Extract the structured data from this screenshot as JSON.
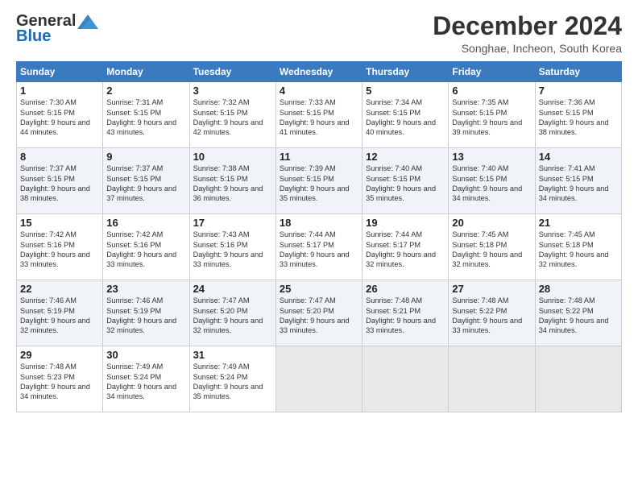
{
  "header": {
    "logo_general": "General",
    "logo_blue": "Blue",
    "month_title": "December 2024",
    "subtitle": "Songhae, Incheon, South Korea"
  },
  "weekdays": [
    "Sunday",
    "Monday",
    "Tuesday",
    "Wednesday",
    "Thursday",
    "Friday",
    "Saturday"
  ],
  "weeks": [
    [
      {
        "day": "1",
        "sunrise": "Sunrise: 7:30 AM",
        "sunset": "Sunset: 5:15 PM",
        "daylight": "Daylight: 9 hours and 44 minutes."
      },
      {
        "day": "2",
        "sunrise": "Sunrise: 7:31 AM",
        "sunset": "Sunset: 5:15 PM",
        "daylight": "Daylight: 9 hours and 43 minutes."
      },
      {
        "day": "3",
        "sunrise": "Sunrise: 7:32 AM",
        "sunset": "Sunset: 5:15 PM",
        "daylight": "Daylight: 9 hours and 42 minutes."
      },
      {
        "day": "4",
        "sunrise": "Sunrise: 7:33 AM",
        "sunset": "Sunset: 5:15 PM",
        "daylight": "Daylight: 9 hours and 41 minutes."
      },
      {
        "day": "5",
        "sunrise": "Sunrise: 7:34 AM",
        "sunset": "Sunset: 5:15 PM",
        "daylight": "Daylight: 9 hours and 40 minutes."
      },
      {
        "day": "6",
        "sunrise": "Sunrise: 7:35 AM",
        "sunset": "Sunset: 5:15 PM",
        "daylight": "Daylight: 9 hours and 39 minutes."
      },
      {
        "day": "7",
        "sunrise": "Sunrise: 7:36 AM",
        "sunset": "Sunset: 5:15 PM",
        "daylight": "Daylight: 9 hours and 38 minutes."
      }
    ],
    [
      {
        "day": "8",
        "sunrise": "Sunrise: 7:37 AM",
        "sunset": "Sunset: 5:15 PM",
        "daylight": "Daylight: 9 hours and 38 minutes."
      },
      {
        "day": "9",
        "sunrise": "Sunrise: 7:37 AM",
        "sunset": "Sunset: 5:15 PM",
        "daylight": "Daylight: 9 hours and 37 minutes."
      },
      {
        "day": "10",
        "sunrise": "Sunrise: 7:38 AM",
        "sunset": "Sunset: 5:15 PM",
        "daylight": "Daylight: 9 hours and 36 minutes."
      },
      {
        "day": "11",
        "sunrise": "Sunrise: 7:39 AM",
        "sunset": "Sunset: 5:15 PM",
        "daylight": "Daylight: 9 hours and 35 minutes."
      },
      {
        "day": "12",
        "sunrise": "Sunrise: 7:40 AM",
        "sunset": "Sunset: 5:15 PM",
        "daylight": "Daylight: 9 hours and 35 minutes."
      },
      {
        "day": "13",
        "sunrise": "Sunrise: 7:40 AM",
        "sunset": "Sunset: 5:15 PM",
        "daylight": "Daylight: 9 hours and 34 minutes."
      },
      {
        "day": "14",
        "sunrise": "Sunrise: 7:41 AM",
        "sunset": "Sunset: 5:15 PM",
        "daylight": "Daylight: 9 hours and 34 minutes."
      }
    ],
    [
      {
        "day": "15",
        "sunrise": "Sunrise: 7:42 AM",
        "sunset": "Sunset: 5:16 PM",
        "daylight": "Daylight: 9 hours and 33 minutes."
      },
      {
        "day": "16",
        "sunrise": "Sunrise: 7:42 AM",
        "sunset": "Sunset: 5:16 PM",
        "daylight": "Daylight: 9 hours and 33 minutes."
      },
      {
        "day": "17",
        "sunrise": "Sunrise: 7:43 AM",
        "sunset": "Sunset: 5:16 PM",
        "daylight": "Daylight: 9 hours and 33 minutes."
      },
      {
        "day": "18",
        "sunrise": "Sunrise: 7:44 AM",
        "sunset": "Sunset: 5:17 PM",
        "daylight": "Daylight: 9 hours and 33 minutes."
      },
      {
        "day": "19",
        "sunrise": "Sunrise: 7:44 AM",
        "sunset": "Sunset: 5:17 PM",
        "daylight": "Daylight: 9 hours and 32 minutes."
      },
      {
        "day": "20",
        "sunrise": "Sunrise: 7:45 AM",
        "sunset": "Sunset: 5:18 PM",
        "daylight": "Daylight: 9 hours and 32 minutes."
      },
      {
        "day": "21",
        "sunrise": "Sunrise: 7:45 AM",
        "sunset": "Sunset: 5:18 PM",
        "daylight": "Daylight: 9 hours and 32 minutes."
      }
    ],
    [
      {
        "day": "22",
        "sunrise": "Sunrise: 7:46 AM",
        "sunset": "Sunset: 5:19 PM",
        "daylight": "Daylight: 9 hours and 32 minutes."
      },
      {
        "day": "23",
        "sunrise": "Sunrise: 7:46 AM",
        "sunset": "Sunset: 5:19 PM",
        "daylight": "Daylight: 9 hours and 32 minutes."
      },
      {
        "day": "24",
        "sunrise": "Sunrise: 7:47 AM",
        "sunset": "Sunset: 5:20 PM",
        "daylight": "Daylight: 9 hours and 32 minutes."
      },
      {
        "day": "25",
        "sunrise": "Sunrise: 7:47 AM",
        "sunset": "Sunset: 5:20 PM",
        "daylight": "Daylight: 9 hours and 33 minutes."
      },
      {
        "day": "26",
        "sunrise": "Sunrise: 7:48 AM",
        "sunset": "Sunset: 5:21 PM",
        "daylight": "Daylight: 9 hours and 33 minutes."
      },
      {
        "day": "27",
        "sunrise": "Sunrise: 7:48 AM",
        "sunset": "Sunset: 5:22 PM",
        "daylight": "Daylight: 9 hours and 33 minutes."
      },
      {
        "day": "28",
        "sunrise": "Sunrise: 7:48 AM",
        "sunset": "Sunset: 5:22 PM",
        "daylight": "Daylight: 9 hours and 34 minutes."
      }
    ],
    [
      {
        "day": "29",
        "sunrise": "Sunrise: 7:48 AM",
        "sunset": "Sunset: 5:23 PM",
        "daylight": "Daylight: 9 hours and 34 minutes."
      },
      {
        "day": "30",
        "sunrise": "Sunrise: 7:49 AM",
        "sunset": "Sunset: 5:24 PM",
        "daylight": "Daylight: 9 hours and 34 minutes."
      },
      {
        "day": "31",
        "sunrise": "Sunrise: 7:49 AM",
        "sunset": "Sunset: 5:24 PM",
        "daylight": "Daylight: 9 hours and 35 minutes."
      },
      null,
      null,
      null,
      null
    ]
  ]
}
